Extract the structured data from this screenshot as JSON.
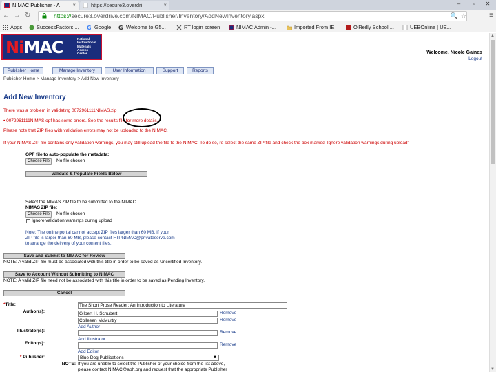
{
  "browser": {
    "tabs": [
      {
        "title": "NIMAC Publisher - A",
        "active": true
      },
      {
        "title": "https://secure3.overdri",
        "active": false
      }
    ],
    "url_scheme": "https://",
    "url_rest": "secure3.overdrive.com/NIMAC/Publisher/Inventory/AddNewInventory.aspx",
    "bookmarks": [
      "Apps",
      "SuccessFactors ...",
      "Google",
      "Welcome to G5...",
      "RT login screen",
      "NIMAC Admin -...",
      "Imported From IE",
      "O'Reilly School ...",
      "UEBOnline | UE..."
    ]
  },
  "logo": {
    "brand_ni": "Ni",
    "brand_mac": "MAC",
    "tagline": [
      "National",
      "Instructional",
      "Materials",
      "Access",
      "Center"
    ]
  },
  "header": {
    "welcome": "Welcome, Nicole Gaines",
    "logout": "Logout"
  },
  "nav": {
    "items": [
      "Publisher Home",
      "Manage Inventory",
      "User Information",
      "Support",
      "Reports"
    ]
  },
  "breadcrumb": "Publisher Home > Manage Inventory > Add New Inventory",
  "page_title": "Add New Inventory",
  "errors": {
    "line1": "There was a problem in validating 0072961111NIMAS.zip",
    "line2": "• 0072961111NIMAS.opf has some errors. See the results file for more details.",
    "line3": "Please note that ZIP files with validation errors may not be uploaded to the NIMAC.",
    "line4": "If your NIMAS ZIP file contains only validation warnings, you may still upload the file to the NIMAC. To do so, re-select the same ZIP file and check the box marked 'Ignore validation warnings during upload'."
  },
  "opf": {
    "label": "OPF file to auto-populate the metadata:",
    "choose": "Choose File",
    "status": "No file chosen",
    "validate_button": "Validate & Populate Fields Below"
  },
  "zip": {
    "select_text": "Select the NIMAS ZIP file to be submitted to the NIMAC.",
    "label": "NIMAS ZIP file:",
    "choose": "Choose File",
    "status": "No file chosen",
    "ignore_label": "Ignore validation warnings during upload",
    "note_lines": [
      "Note: The online portal cannot accept ZIP files larger than 60 MB. If your",
      "ZIP file is larger than 60 MB, please contact FTPNIMAC@privateserve.com",
      "to arrange the delivery of your content files."
    ]
  },
  "actions": {
    "submit_button": "Save and Submit to NIMAC for Review",
    "submit_note": "NOTE: A valid ZIP file must be associated with this title in order to be saved as Uncertified Inventory.",
    "save_button": "Save to Account Without Submitting to NIMAC",
    "save_note": "NOTE: A valid ZIP file need not be associated with this title in order to be saved as Pending Inventory.",
    "cancel_button": "Cancel"
  },
  "form": {
    "required_mark": "*",
    "title_label": "Title:",
    "title_value": "The Short Prose Reader: An Introduction to Literature",
    "authors_label": "Author(s):",
    "authors": [
      "Gilbert H. Schubert",
      "Colleeen McMurtry"
    ],
    "remove": "Remove",
    "add_author": "Add Author",
    "illustrators_label": "Illustrator(s):",
    "add_illustrator": "Add Illustrator",
    "editors_label": "Editor(s):",
    "add_editor": "Add Editor",
    "publisher_label": "Publisher:",
    "publisher_value": "Blue Dog Publications",
    "note_label": "NOTE:",
    "publisher_note_lines": [
      "If you are unable to select the Publisher of your choice from the list above,",
      "please contact NIMAC@aph.org and request that the appropriate Publisher"
    ]
  }
}
